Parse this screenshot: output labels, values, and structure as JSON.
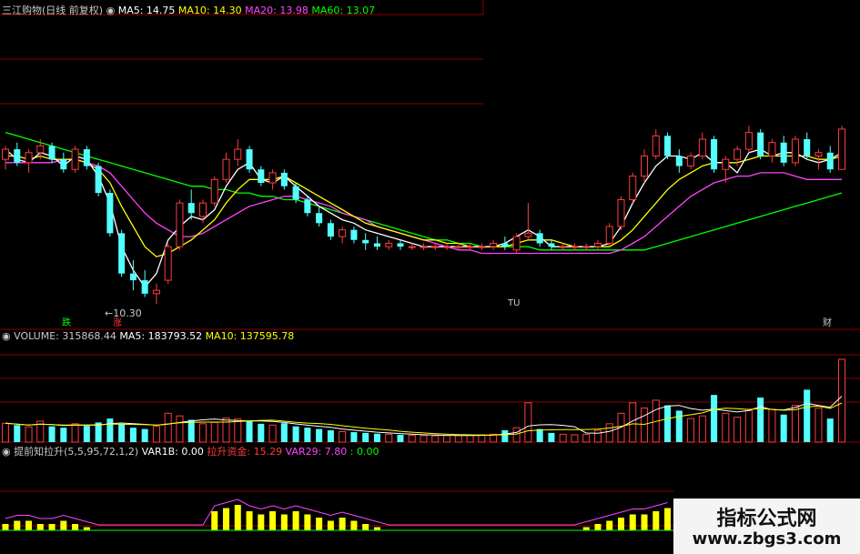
{
  "colors": {
    "background": "#000000",
    "grid": "#8b0000",
    "rise": "#ff3b3b",
    "fall": "#54ffff",
    "ma5": "#ffffff",
    "ma10": "#ffff00",
    "ma20": "#ff44ff",
    "ma60": "#00ff00",
    "yellow_bar": "#ffff00",
    "label": "#c8c8c8"
  },
  "price_panel": {
    "stock_name": "三江购物(日线 前复权)",
    "ma_labels": [
      {
        "text": "MA5: 14.75",
        "color": "#ffffff"
      },
      {
        "text": "MA10: 14.30",
        "color": "#ffff00"
      },
      {
        "text": "MA20: 13.98",
        "color": "#ff44ff"
      },
      {
        "text": "MA60: 13.07",
        "color": "#00ff00"
      }
    ],
    "low_annotation": "←10.30",
    "markers": {
      "die": "跌",
      "zhang": "涨",
      "tu": "TU",
      "cai": "财"
    }
  },
  "volume_panel": {
    "labels": [
      {
        "text": "VOLUME: 315868.44",
        "color": "#c8c8c8"
      },
      {
        "text": "MA5: 183793.52",
        "color": "#ffffff"
      },
      {
        "text": "MA10: 137595.78",
        "color": "#ffff00"
      }
    ]
  },
  "indicator_panel": {
    "labels": [
      {
        "text": "提前知拉升(5,5,95,72,1,2)",
        "color": "#c8c8c8"
      },
      {
        "text": "VAR1B: 0.00",
        "color": "#ffffff"
      },
      {
        "text": "拉升资金: 15.29",
        "color": "#ff3b3b"
      },
      {
        "text": "VAR29: 7.80",
        "color": "#ff44ff"
      },
      {
        "text": ": 0.00",
        "color": "#00ff00"
      }
    ]
  },
  "watermark": {
    "line1": "指标公式网",
    "line2": "www.zbgs3.com"
  },
  "chart_data": [
    {
      "type": "candlestick",
      "title": "三江购物(日线 前复权)",
      "annotations": [
        "←10.30"
      ],
      "series": [
        {
          "name": "MA5",
          "values": [
            14.9,
            14.6,
            14.5,
            14.8,
            14.7,
            14.4,
            14.7,
            14.6,
            14.1,
            13.3,
            12.0,
            11.3,
            10.8,
            11.2,
            12.2,
            12.6,
            12.9,
            12.8,
            13.1,
            13.8,
            14.3,
            14.5,
            14.0,
            13.9,
            14.1,
            13.8,
            13.5,
            13.2,
            13.0,
            12.8,
            12.7,
            12.5,
            12.4,
            12.3,
            12.2,
            12.1,
            12.0,
            12.0,
            12.0,
            12.0,
            12.0,
            12.0,
            12.0,
            12.1,
            12.3,
            12.5,
            12.3,
            12.0,
            12.0,
            12.0,
            12.0,
            12.0,
            12.1,
            12.6,
            13.3,
            13.9,
            14.4,
            14.7,
            14.7,
            14.6,
            14.8,
            14.5,
            14.5,
            14.2,
            14.8,
            14.9,
            14.7,
            14.8,
            14.8,
            14.6,
            14.5,
            14.6,
            14.8
          ]
        },
        {
          "name": "MA10",
          "values": [
            14.7,
            14.7,
            14.6,
            14.7,
            14.6,
            14.6,
            14.6,
            14.5,
            14.3,
            13.9,
            13.2,
            12.6,
            12.0,
            11.7,
            11.8,
            12.0,
            12.2,
            12.5,
            12.8,
            13.3,
            13.7,
            14.0,
            14.0,
            14.0,
            14.1,
            13.9,
            13.7,
            13.5,
            13.3,
            13.1,
            12.9,
            12.7,
            12.6,
            12.5,
            12.4,
            12.3,
            12.2,
            12.2,
            12.1,
            12.1,
            12.0,
            12.0,
            12.0,
            12.0,
            12.1,
            12.2,
            12.2,
            12.2,
            12.1,
            12.0,
            12.0,
            12.0,
            12.0,
            12.2,
            12.5,
            12.9,
            13.3,
            13.7,
            14.0,
            14.2,
            14.4,
            14.5,
            14.5,
            14.5,
            14.6,
            14.7,
            14.7,
            14.7,
            14.7,
            14.7,
            14.6,
            14.6,
            14.7
          ]
        },
        {
          "name": "MA20",
          "values": [
            14.5,
            14.5,
            14.5,
            14.5,
            14.5,
            14.6,
            14.6,
            14.5,
            14.4,
            14.2,
            13.8,
            13.4,
            13.0,
            12.7,
            12.5,
            12.3,
            12.3,
            12.4,
            12.6,
            12.8,
            13.0,
            13.2,
            13.3,
            13.4,
            13.5,
            13.5,
            13.4,
            13.3,
            13.2,
            13.0,
            12.9,
            12.8,
            12.6,
            12.5,
            12.4,
            12.3,
            12.2,
            12.1,
            12.0,
            11.9,
            11.9,
            11.8,
            11.8,
            11.8,
            11.8,
            11.8,
            11.8,
            11.8,
            11.8,
            11.8,
            11.8,
            11.8,
            11.8,
            11.9,
            12.1,
            12.3,
            12.6,
            12.9,
            13.2,
            13.5,
            13.7,
            13.9,
            14.0,
            14.1,
            14.1,
            14.2,
            14.2,
            14.2,
            14.1,
            14.0,
            14.0,
            14.0,
            14.0
          ]
        },
        {
          "name": "MA60",
          "values": [
            15.4,
            15.3,
            15.2,
            15.1,
            15.0,
            14.9,
            14.8,
            14.7,
            14.6,
            14.5,
            14.4,
            14.3,
            14.2,
            14.1,
            14.0,
            13.9,
            13.8,
            13.8,
            13.7,
            13.7,
            13.6,
            13.6,
            13.5,
            13.5,
            13.4,
            13.4,
            13.3,
            13.2,
            13.1,
            13.0,
            12.9,
            12.8,
            12.7,
            12.6,
            12.5,
            12.4,
            12.3,
            12.2,
            12.2,
            12.1,
            12.1,
            12.0,
            12.0,
            12.0,
            12.0,
            12.0,
            11.9,
            11.9,
            11.9,
            11.9,
            11.9,
            11.9,
            11.9,
            11.9,
            11.9,
            11.9,
            12.0,
            12.1,
            12.2,
            12.3,
            12.4,
            12.5,
            12.6,
            12.7,
            12.8,
            12.9,
            13.0,
            13.1,
            13.2,
            13.3,
            13.4,
            13.5,
            13.6
          ]
        }
      ],
      "candles": [
        [
          14.6,
          15.0,
          14.3,
          14.9
        ],
        [
          14.9,
          15.1,
          14.4,
          14.5
        ],
        [
          14.5,
          14.9,
          14.2,
          14.8
        ],
        [
          14.8,
          15.2,
          14.6,
          15.0
        ],
        [
          15.0,
          15.1,
          14.5,
          14.6
        ],
        [
          14.6,
          14.8,
          14.2,
          14.3
        ],
        [
          14.3,
          15.0,
          14.2,
          14.9
        ],
        [
          14.9,
          15.0,
          14.3,
          14.4
        ],
        [
          14.4,
          14.5,
          13.5,
          13.6
        ],
        [
          13.6,
          13.7,
          12.3,
          12.4
        ],
        [
          12.4,
          12.5,
          11.1,
          11.2
        ],
        [
          11.2,
          11.6,
          10.7,
          11.0
        ],
        [
          11.0,
          11.3,
          10.5,
          10.6
        ],
        [
          10.6,
          10.9,
          10.3,
          10.7
        ],
        [
          11.0,
          12.1,
          10.9,
          12.0
        ],
        [
          12.0,
          13.4,
          11.9,
          13.3
        ],
        [
          13.3,
          13.7,
          12.8,
          13.0
        ],
        [
          12.9,
          13.4,
          12.7,
          13.3
        ],
        [
          13.3,
          14.1,
          13.2,
          14.0
        ],
        [
          14.0,
          14.8,
          13.9,
          14.6
        ],
        [
          14.6,
          15.2,
          14.4,
          14.9
        ],
        [
          14.9,
          15.0,
          14.2,
          14.3
        ],
        [
          14.3,
          14.4,
          13.8,
          13.9
        ],
        [
          13.9,
          14.3,
          13.7,
          14.2
        ],
        [
          14.2,
          14.3,
          13.7,
          13.8
        ],
        [
          13.8,
          13.9,
          13.3,
          13.4
        ],
        [
          13.4,
          13.5,
          12.9,
          13.0
        ],
        [
          13.0,
          13.2,
          12.6,
          12.7
        ],
        [
          12.7,
          12.8,
          12.2,
          12.3
        ],
        [
          12.3,
          12.6,
          12.1,
          12.5
        ],
        [
          12.5,
          12.6,
          12.1,
          12.2
        ],
        [
          12.2,
          12.4,
          11.9,
          12.1
        ],
        [
          12.1,
          12.3,
          11.9,
          12.0
        ],
        [
          12.0,
          12.2,
          11.9,
          12.1
        ],
        [
          12.1,
          12.2,
          11.9,
          12.0
        ],
        [
          12.0,
          12.1,
          11.9,
          12.0
        ],
        [
          12.0,
          12.1,
          11.9,
          12.0
        ],
        [
          12.0,
          12.1,
          11.9,
          12.0
        ],
        [
          12.0,
          12.1,
          11.9,
          12.0
        ],
        [
          12.0,
          12.1,
          11.9,
          12.0
        ],
        [
          12.0,
          12.1,
          11.9,
          12.0
        ],
        [
          12.0,
          12.1,
          11.9,
          12.0
        ],
        [
          12.0,
          12.2,
          11.9,
          12.1
        ],
        [
          12.1,
          12.3,
          11.9,
          12.0
        ],
        [
          11.9,
          12.4,
          11.8,
          12.3
        ],
        [
          12.3,
          13.3,
          12.2,
          12.4
        ],
        [
          12.4,
          12.5,
          12.0,
          12.1
        ],
        [
          12.1,
          12.2,
          11.9,
          12.0
        ],
        [
          12.0,
          12.1,
          11.9,
          12.0
        ],
        [
          12.0,
          12.1,
          11.9,
          12.0
        ],
        [
          12.0,
          12.1,
          11.9,
          12.0
        ],
        [
          12.0,
          12.2,
          11.9,
          12.1
        ],
        [
          12.1,
          12.7,
          12.0,
          12.6
        ],
        [
          12.6,
          13.5,
          12.5,
          13.4
        ],
        [
          13.4,
          14.2,
          13.3,
          14.1
        ],
        [
          14.1,
          14.9,
          13.9,
          14.7
        ],
        [
          14.7,
          15.5,
          14.6,
          15.3
        ],
        [
          15.3,
          15.4,
          14.6,
          14.7
        ],
        [
          14.7,
          14.9,
          14.2,
          14.4
        ],
        [
          14.4,
          14.8,
          14.3,
          14.7
        ],
        [
          14.7,
          15.4,
          14.6,
          15.2
        ],
        [
          15.2,
          15.3,
          14.2,
          14.3
        ],
        [
          14.3,
          14.7,
          13.9,
          14.6
        ],
        [
          14.6,
          15.0,
          14.4,
          14.9
        ],
        [
          14.9,
          15.6,
          14.8,
          15.4
        ],
        [
          15.4,
          15.5,
          14.6,
          14.7
        ],
        [
          14.7,
          15.2,
          14.5,
          15.1
        ],
        [
          15.1,
          15.3,
          14.4,
          14.5
        ],
        [
          14.5,
          15.3,
          14.4,
          15.2
        ],
        [
          15.2,
          15.4,
          14.6,
          14.7
        ],
        [
          14.7,
          14.9,
          14.3,
          14.8
        ],
        [
          14.8,
          15.0,
          14.2,
          14.3
        ],
        [
          14.3,
          15.6,
          14.3,
          15.5
        ]
      ]
    },
    {
      "type": "bar",
      "title": "VOLUME",
      "values": [
        72000,
        65000,
        58000,
        80000,
        60000,
        55000,
        70000,
        62000,
        75000,
        90000,
        68000,
        55000,
        50000,
        60000,
        110000,
        100000,
        85000,
        70000,
        75000,
        92000,
        88000,
        80000,
        70000,
        65000,
        72000,
        60000,
        55000,
        50000,
        45000,
        40000,
        38000,
        35000,
        32000,
        30000,
        28000,
        26000,
        25000,
        24000,
        25000,
        25000,
        26000,
        28000,
        30000,
        45000,
        55000,
        150000,
        50000,
        35000,
        30000,
        28000,
        30000,
        45000,
        70000,
        110000,
        150000,
        130000,
        160000,
        140000,
        120000,
        90000,
        100000,
        180000,
        110000,
        95000,
        120000,
        170000,
        125000,
        105000,
        140000,
        200000,
        130000,
        90000,
        315868
      ]
    },
    {
      "type": "bar",
      "title": "提前知拉升(5,5,95,72,1,2)",
      "values": [
        2,
        3,
        3,
        2,
        2,
        3,
        2,
        1,
        0,
        0,
        0,
        0,
        0,
        0,
        0,
        0,
        0,
        0,
        6,
        7,
        8,
        6,
        5,
        6,
        5,
        6,
        5,
        4,
        3,
        4,
        3,
        2,
        1,
        0,
        0,
        0,
        0,
        0,
        0,
        0,
        0,
        0,
        0,
        0,
        0,
        0,
        0,
        0,
        0,
        0,
        1,
        2,
        3,
        4,
        5,
        5,
        6,
        7,
        7,
        6,
        5,
        4,
        5,
        5,
        4,
        3,
        3,
        4,
        4,
        3,
        3,
        2,
        3
      ]
    }
  ]
}
